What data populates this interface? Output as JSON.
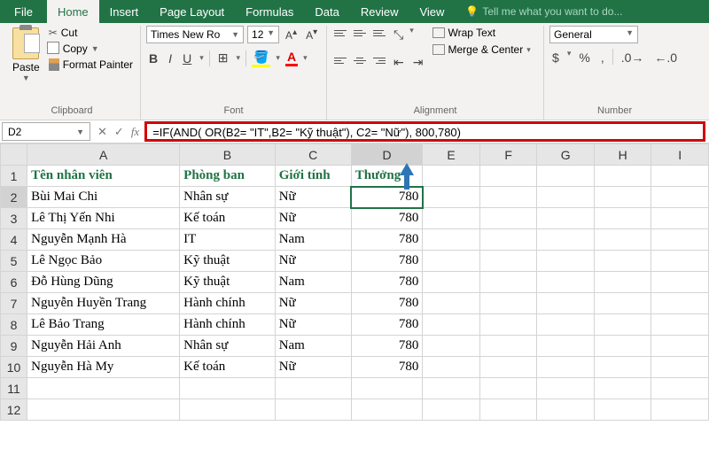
{
  "tabs": {
    "file": "File",
    "home": "Home",
    "insert": "Insert",
    "page_layout": "Page Layout",
    "formulas": "Formulas",
    "data": "Data",
    "review": "Review",
    "view": "View",
    "tell": "Tell me what you want to do..."
  },
  "ribbon": {
    "clipboard": {
      "label": "Clipboard",
      "paste": "Paste",
      "cut": "Cut",
      "copy": "Copy",
      "painter": "Format Painter"
    },
    "font": {
      "label": "Font",
      "name": "Times New Ro",
      "size": "12"
    },
    "alignment": {
      "label": "Alignment",
      "wrap": "Wrap Text",
      "merge": "Merge & Center"
    },
    "number": {
      "label": "Number",
      "format": "General"
    }
  },
  "formula": {
    "cell": "D2",
    "value": "=IF(AND( OR(B2= \"IT\",B2= \"Kỹ thuật\"), C2= \"Nữ\"), 800,780)"
  },
  "columns": [
    "A",
    "B",
    "C",
    "D",
    "E",
    "F",
    "G",
    "H",
    "I"
  ],
  "headers": {
    "A": "Tên nhân viên",
    "B": "Phòng ban",
    "C": "Giới tính",
    "D": "Thưởng"
  },
  "rows": [
    {
      "n": 1,
      "A": "Tên nhân viên",
      "B": "Phòng ban",
      "C": "Giới tính",
      "D": "Thưởng",
      "header": true
    },
    {
      "n": 2,
      "A": "Bùi Mai Chi",
      "B": "Nhân sự",
      "C": "Nữ",
      "D": "780"
    },
    {
      "n": 3,
      "A": "Lê Thị Yến Nhi",
      "B": "Kế toán",
      "C": "Nữ",
      "D": "780"
    },
    {
      "n": 4,
      "A": "Nguyễn Mạnh Hà",
      "B": "IT",
      "C": "Nam",
      "D": "780"
    },
    {
      "n": 5,
      "A": "Lê Ngọc Bảo",
      "B": "Kỹ thuật",
      "C": "Nữ",
      "D": "780"
    },
    {
      "n": 6,
      "A": "Đỗ Hùng Dũng",
      "B": "Kỹ thuật",
      "C": "Nam",
      "D": "780"
    },
    {
      "n": 7,
      "A": "Nguyễn Huyền Trang",
      "B": "Hành chính",
      "C": "Nữ",
      "D": "780"
    },
    {
      "n": 8,
      "A": "Lê Bảo Trang",
      "B": "Hành chính",
      "C": "Nữ",
      "D": "780"
    },
    {
      "n": 9,
      "A": "Nguyễn Hải Anh",
      "B": "Nhân sự",
      "C": "Nam",
      "D": "780"
    },
    {
      "n": 10,
      "A": "Nguyễn Hà My",
      "B": "Kế toán",
      "C": "Nữ",
      "D": "780"
    },
    {
      "n": 11,
      "A": "",
      "B": "",
      "C": "",
      "D": ""
    },
    {
      "n": 12,
      "A": "",
      "B": "",
      "C": "",
      "D": ""
    }
  ]
}
